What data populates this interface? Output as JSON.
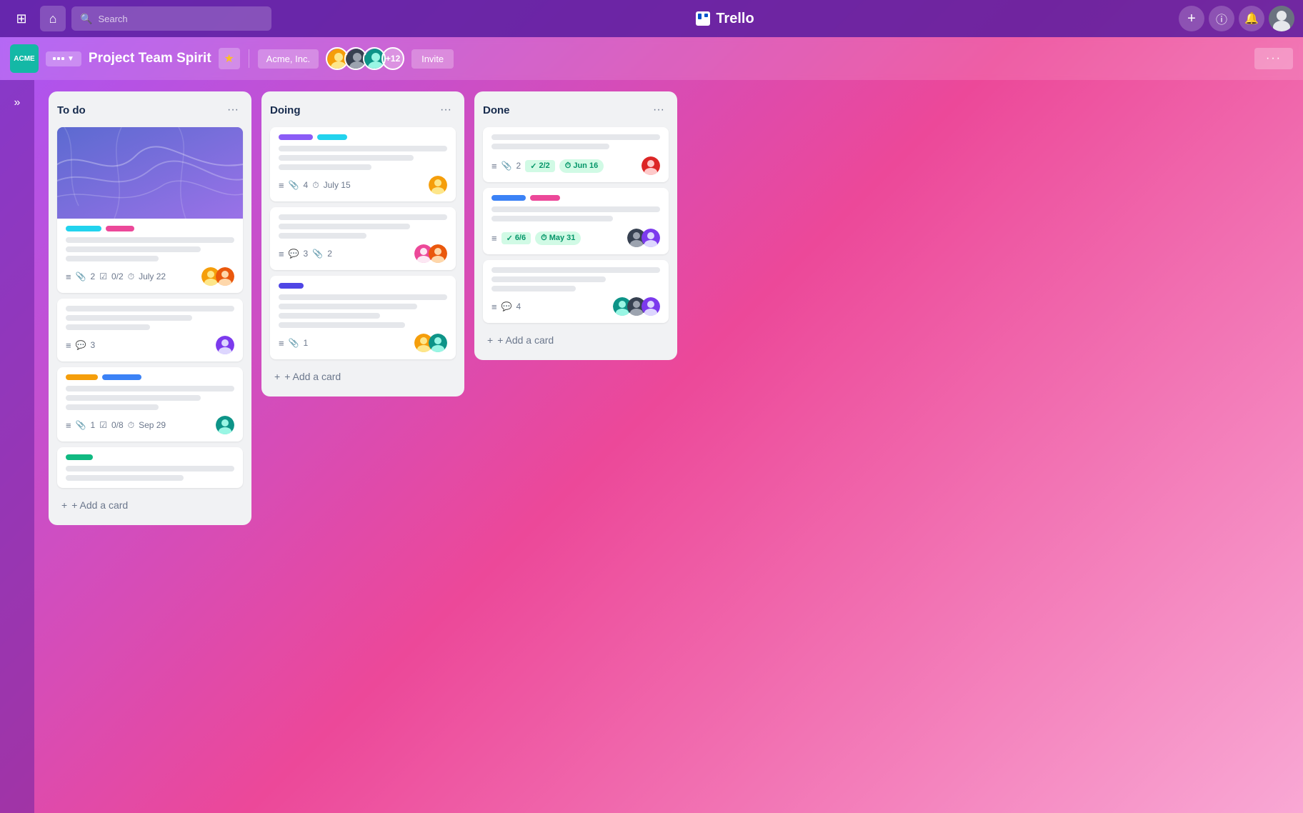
{
  "app": {
    "title": "Trello",
    "board_name": "Project Team Spirit",
    "workspace": "Acme, Inc."
  },
  "nav": {
    "search_placeholder": "Search",
    "plus_label": "+",
    "info_label": "ℹ",
    "bell_label": "🔔",
    "apps_label": "⊞",
    "home_label": "⌂",
    "more_label": "···"
  },
  "board_header": {
    "workspace_logo": "ACME",
    "board_menu_label": "···",
    "star_label": "★",
    "workspace_btn": "Acme, Inc.",
    "member_count": "+12",
    "invite_btn": "Invite",
    "more_btn": "···"
  },
  "sidebar": {
    "toggle_label": "»"
  },
  "columns": [
    {
      "id": "todo",
      "title": "To do",
      "cards": [
        {
          "id": "card-1",
          "has_cover": true,
          "tags": [
            "cyan",
            "pink"
          ],
          "lines": [
            "full",
            "medium",
            "short"
          ],
          "meta": {
            "has_desc": true,
            "attachments": "2",
            "checklist": "0/2",
            "date": "July 22"
          },
          "avatars": [
            "yellow",
            "orange"
          ]
        },
        {
          "id": "card-2",
          "has_cover": false,
          "tags": [],
          "lines": [
            "full",
            "medium",
            "short"
          ],
          "meta": {
            "has_desc": true,
            "comments": "3"
          },
          "avatars": [
            "purple"
          ]
        },
        {
          "id": "card-3",
          "has_cover": false,
          "tags": [
            "yellow",
            "blue"
          ],
          "lines": [
            "full",
            "medium",
            "short"
          ],
          "meta": {
            "has_desc": true,
            "attachments": "1",
            "checklist": "0/8",
            "date": "Sep 29"
          },
          "avatars": [
            "teal"
          ]
        },
        {
          "id": "card-4",
          "has_cover": false,
          "tags": [
            "green"
          ],
          "lines": [
            "full",
            "medium"
          ],
          "meta": {},
          "avatars": []
        }
      ],
      "add_card_label": "+ Add a card"
    },
    {
      "id": "doing",
      "title": "Doing",
      "cards": [
        {
          "id": "card-5",
          "has_cover": false,
          "tags": [
            "purple",
            "teal"
          ],
          "lines": [
            "full",
            "medium",
            "short"
          ],
          "meta": {
            "has_desc": true,
            "attachments": "4",
            "date": "July 15"
          },
          "avatars": [
            "yellow"
          ]
        },
        {
          "id": "card-6",
          "has_cover": false,
          "tags": [],
          "lines": [
            "full",
            "medium",
            "short"
          ],
          "meta": {
            "has_desc": true,
            "comments": "3",
            "attachments": "2"
          },
          "avatars": [
            "pink",
            "orange"
          ]
        },
        {
          "id": "card-7",
          "has_cover": false,
          "tags": [
            "indigo"
          ],
          "lines": [
            "full",
            "medium",
            "short",
            "medium"
          ],
          "meta": {
            "has_desc": true,
            "attachments": "1"
          },
          "avatars": [
            "yellow",
            "teal"
          ]
        }
      ],
      "add_card_label": "+ Add a card"
    },
    {
      "id": "done",
      "title": "Done",
      "cards": [
        {
          "id": "card-8",
          "has_cover": false,
          "tags": [],
          "lines": [
            "full",
            "medium"
          ],
          "meta": {
            "has_desc": true,
            "attachments": "2",
            "checklist_badge": "2/2",
            "date_badge": "Jun 16"
          },
          "avatars": [
            "red"
          ]
        },
        {
          "id": "card-9",
          "has_cover": false,
          "tags": [
            "blue",
            "pink"
          ],
          "lines": [
            "full",
            "medium"
          ],
          "meta": {
            "has_desc": true,
            "checklist_badge": "6/6",
            "date_badge": "May 31"
          },
          "avatars": [
            "dark",
            "purple"
          ]
        },
        {
          "id": "card-10",
          "has_cover": false,
          "tags": [],
          "lines": [
            "full",
            "medium",
            "short"
          ],
          "meta": {
            "has_desc": true,
            "comments": "4"
          },
          "avatars": [
            "teal",
            "dark",
            "purple"
          ]
        }
      ],
      "add_card_label": "+ Add a card"
    }
  ]
}
